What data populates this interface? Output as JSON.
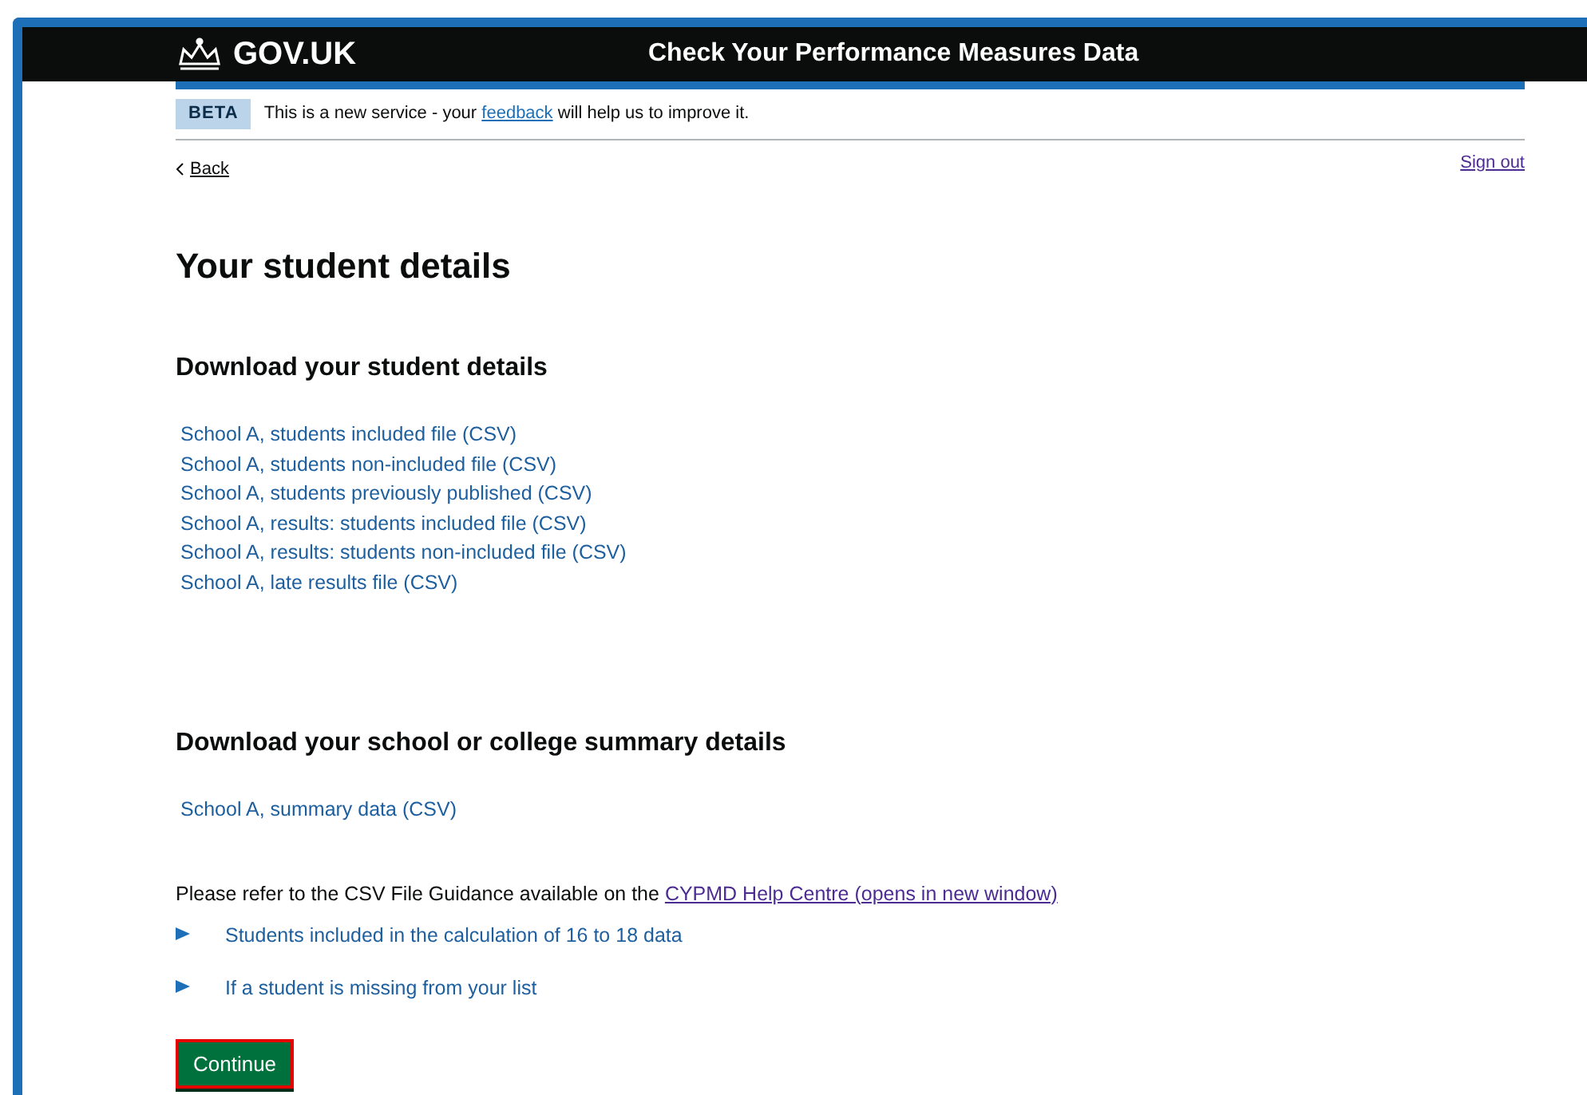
{
  "header": {
    "logo": "GOV.UK",
    "service_name": "Check Your Performance Measures Data"
  },
  "phase_banner": {
    "tag": "BETA",
    "text_before": "This is a new service - your ",
    "link": "feedback",
    "text_after": " will help us to improve it."
  },
  "back_link": "Back",
  "sign_out": "Sign out",
  "title": "Your student details",
  "student_section": {
    "heading": "Download your student details",
    "links": [
      "School A, students included file (CSV)",
      "School A, students non-included file (CSV)",
      "School A, students previously published (CSV)",
      "School A, results: students included file (CSV)",
      "School A, results: students non-included file (CSV)",
      "School A, late results file (CSV)"
    ]
  },
  "summary_section": {
    "heading": "Download your school or college summary details",
    "links": [
      "School A, summary data (CSV)"
    ]
  },
  "guidance": {
    "text": "Please refer to the CSV File Guidance available on the ",
    "link": "CYPMD Help Centre (opens in new window)"
  },
  "details": [
    {
      "summary": "Students included in the calculation of 16 to 18 data",
      "expanded": false
    },
    {
      "summary": "If a student is missing from your list",
      "expanded": false
    }
  ],
  "continue_button": "Continue"
}
